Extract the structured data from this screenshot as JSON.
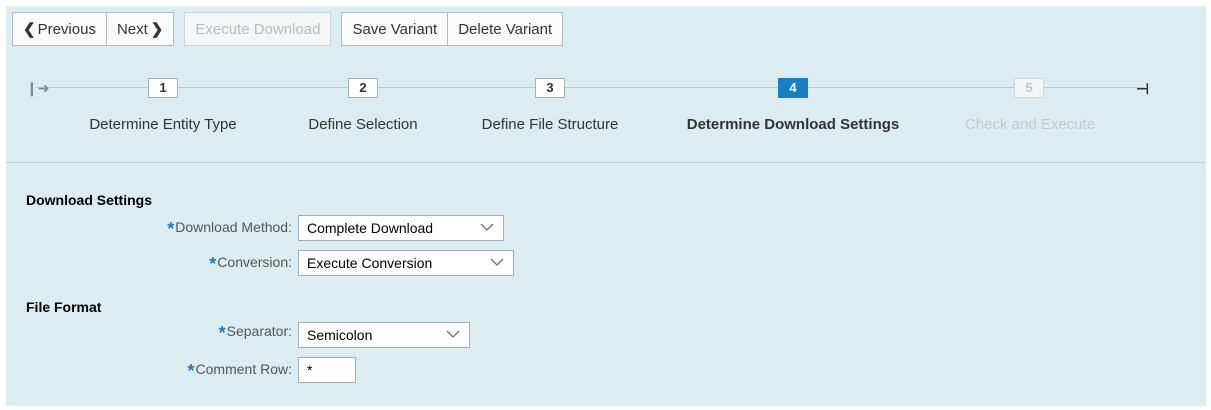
{
  "toolbar": {
    "previous_label": "Previous",
    "next_label": "Next",
    "execute_download_label": "Execute Download",
    "save_variant_label": "Save Variant",
    "delete_variant_label": "Delete Variant"
  },
  "roadmap": {
    "steps": [
      {
        "number": "1",
        "label": "Determine Entity Type",
        "state": "done"
      },
      {
        "number": "2",
        "label": "Define Selection",
        "state": "done"
      },
      {
        "number": "3",
        "label": "Define File Structure",
        "state": "done"
      },
      {
        "number": "4",
        "label": "Determine Download Settings",
        "state": "active"
      },
      {
        "number": "5",
        "label": "Check and Execute",
        "state": "future"
      }
    ]
  },
  "download_settings": {
    "title": "Download Settings",
    "method_label": "Download Method:",
    "method_value": "Complete Download",
    "conversion_label": "Conversion:",
    "conversion_value": "Execute Conversion"
  },
  "file_format": {
    "title": "File Format",
    "separator_label": "Separator:",
    "separator_value": "Semicolon",
    "comment_row_label": "Comment Row:",
    "comment_row_value": "*"
  },
  "colors": {
    "panel_bg": "#dcedf1",
    "accent": "#1a7ec3",
    "required_star": "#1a7ec3"
  }
}
